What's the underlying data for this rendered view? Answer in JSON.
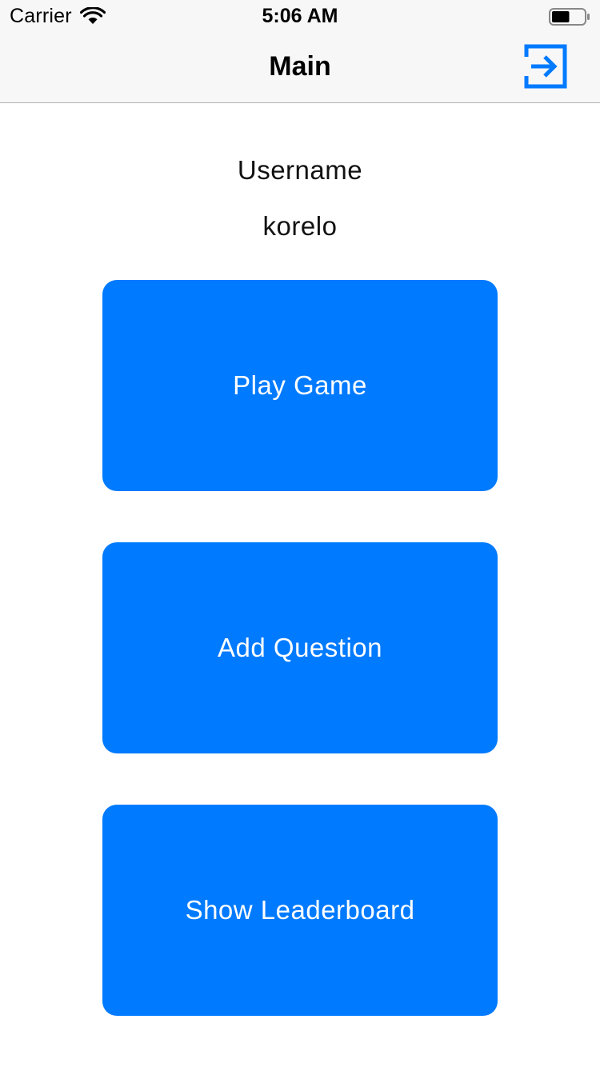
{
  "status_bar": {
    "carrier": "Carrier",
    "time": "5:06 AM",
    "wifi_icon": "wifi-icon",
    "battery_icon": "battery-icon",
    "battery_level": 0.55
  },
  "nav": {
    "title": "Main",
    "right_icon": "logout-icon"
  },
  "profile": {
    "label": "Username",
    "value": "korelo"
  },
  "actions": {
    "play": "Play Game",
    "add": "Add Question",
    "leaderboard": "Show Leaderboard"
  },
  "colors": {
    "accent": "#007aff",
    "nav_background": "#f7f7f7",
    "text": "#111111"
  }
}
